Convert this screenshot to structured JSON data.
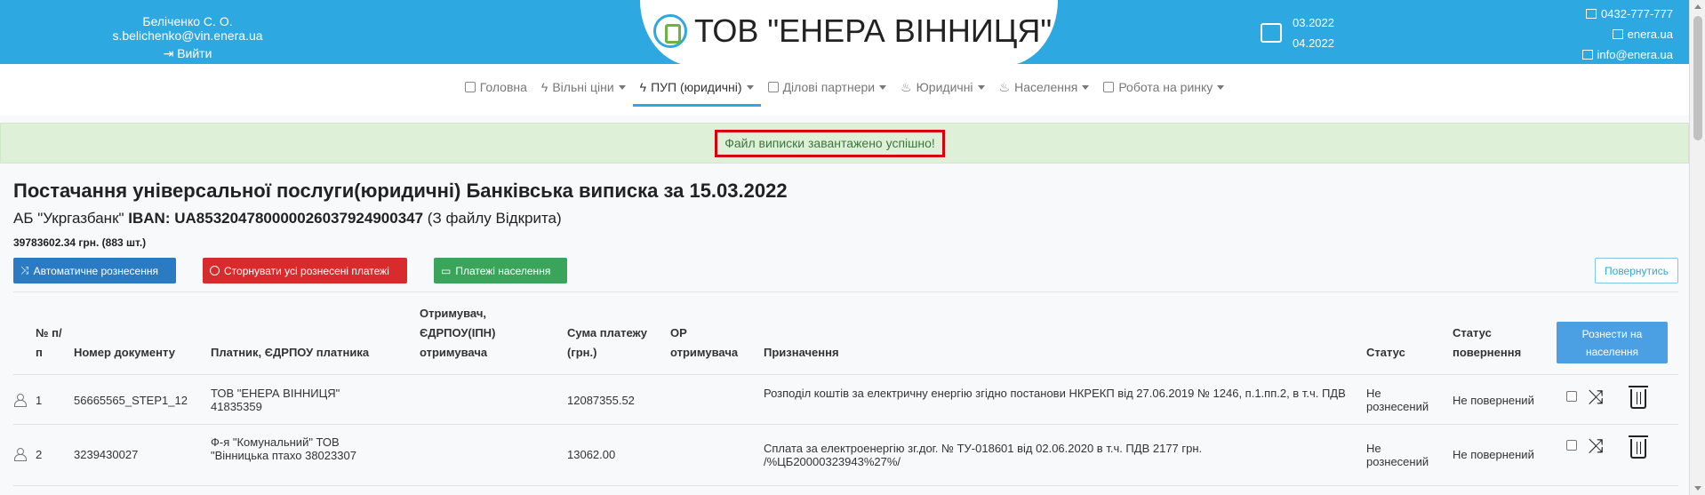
{
  "header": {
    "user": "Беліченко С. О. s.belichenko@vin.enera.ua",
    "logout": "Вийти",
    "title": "ТОВ \"ЕНЕРА ВІННИЦЯ\"",
    "dates": [
      "03.2022",
      "04.2022"
    ],
    "phone": "0432-777-777",
    "site": "enera.ua",
    "email": "info@enera.ua",
    "accent_color": "#2ea8e0"
  },
  "nav": [
    {
      "label": "Головна",
      "icon": "home-icon",
      "dropdown": false,
      "active": false
    },
    {
      "label": "Вільні ціни",
      "icon": "bolt-icon",
      "dropdown": true,
      "active": false
    },
    {
      "label": "ПУП (юридичні)",
      "icon": "bolt-icon",
      "dropdown": true,
      "active": true
    },
    {
      "label": "Ділові партнери",
      "icon": "book-icon",
      "dropdown": true,
      "active": false
    },
    {
      "label": "Юридичні",
      "icon": "flame-icon",
      "dropdown": true,
      "active": false
    },
    {
      "label": "Населення",
      "icon": "flame-icon",
      "dropdown": true,
      "active": false
    },
    {
      "label": "Робота на ринку",
      "icon": "chart-icon",
      "dropdown": true,
      "active": false
    }
  ],
  "alert": {
    "text": "Файл виписки завантажено успішно!"
  },
  "page": {
    "title": "Постачання універсальної послуги(юридичні) Банківська виписка за 15.03.2022",
    "bank": "АБ \"Укргазбанк\"",
    "iban_label": "IBAN:",
    "iban": "UA853204780000026037924900347",
    "file_note": "(З файлу Відкрита)",
    "total": "39783602.34 грн. (883 шт.)"
  },
  "buttons": {
    "auto": "Автоматичне рознесення",
    "storno": "Сторнувати усі рознесені платежі",
    "population": "Платежі населення",
    "back": "Повернутись",
    "distribute": "Рознести на населення"
  },
  "table": {
    "headers": {
      "num": "№ п/п",
      "doc": "Номер документу",
      "payer": "Платник, ЄДРПОУ платника",
      "receiver": "Отримувач, ЄДРПОУ(ІПН) отримувача",
      "sum": "Сума платежу (грн.)",
      "or": "ОР отримувача",
      "purpose": "Призначення",
      "status": "Статус",
      "return_status": "Статус повернення"
    },
    "rows": [
      {
        "num": "1",
        "doc": "56665565_STEP1_12",
        "payer": "ТОВ \"ЕНЕРА ВІННИЦЯ\" 41835359",
        "receiver": "",
        "sum": "12087355.52",
        "or": "",
        "purpose": "Розподіл коштів за електричну енергію згідно постанови НКРЕКП від 27.06.2019 № 1246, п.1.пп.2, в т.ч. ПДВ",
        "status": "Не рознесений",
        "return_status": "Не повернений"
      },
      {
        "num": "2",
        "doc": "3239430027",
        "payer": "Ф-я \"Комунальний\" ТОВ \"Вінницька птахо 38023307",
        "receiver": "",
        "sum": "13062.00",
        "or": "",
        "purpose": "Сплата за електроенергію зг.дог. № ТУ-018601 від 02.06.2020 в т.ч. ПДВ 2177 грн. /%ЦБ20000323943%27%/",
        "status": "Не рознесений",
        "return_status": "Не повернений"
      }
    ]
  }
}
